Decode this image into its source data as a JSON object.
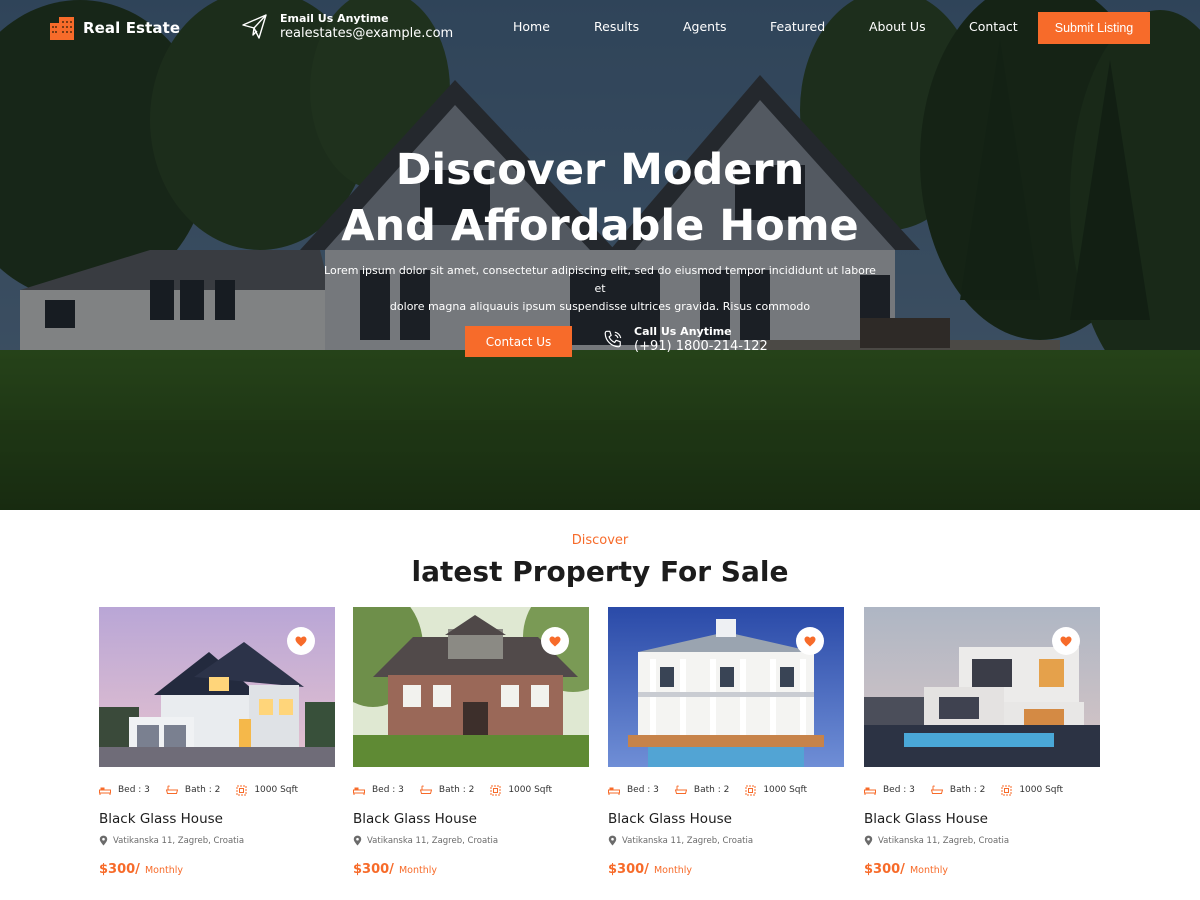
{
  "brand": {
    "name": "Real Estate",
    "accent": "#f76b2a"
  },
  "header": {
    "email_label": "Email Us Anytime",
    "email_value": "realestates@example.com",
    "nav": [
      "Home",
      "Results",
      "Agents",
      "Featured",
      "About Us",
      "Contact"
    ],
    "submit_label": "Submit Listing"
  },
  "hero": {
    "title_line1": "Discover Modern",
    "title_line2": "And Affordable Home",
    "description_line1": "Lorem ipsum dolor sit amet, consectetur adipiscing elit, sed do eiusmod tempor incididunt ut labore et",
    "description_line2": "dolore magna aliquauis ipsum suspendisse ultrices gravida. Risus commodo",
    "contact_label": "Contact Us",
    "call_label": "Call Us Anytime",
    "call_value": "(+91) 1800-214-122"
  },
  "section": {
    "kicker": "Discover",
    "title": "latest Property For Sale"
  },
  "properties": [
    {
      "bed": "Bed : 3",
      "bath": "Bath : 2",
      "area": "1000 Sqft",
      "title": "Black Glass House",
      "address": "Vatikanska 11, Zagreb, Croatia",
      "price": "$300/",
      "period": "Monthly"
    },
    {
      "bed": "Bed : 3",
      "bath": "Bath : 2",
      "area": "1000 Sqft",
      "title": "Black Glass House",
      "address": "Vatikanska 11, Zagreb, Croatia",
      "price": "$300/",
      "period": "Monthly"
    },
    {
      "bed": "Bed : 3",
      "bath": "Bath : 2",
      "area": "1000 Sqft",
      "title": "Black Glass House",
      "address": "Vatikanska 11, Zagreb, Croatia",
      "price": "$300/",
      "period": "Monthly"
    },
    {
      "bed": "Bed : 3",
      "bath": "Bath : 2",
      "area": "1000 Sqft",
      "title": "Black Glass House",
      "address": "Vatikanska 11, Zagreb, Croatia",
      "price": "$300/",
      "period": "Monthly"
    }
  ]
}
